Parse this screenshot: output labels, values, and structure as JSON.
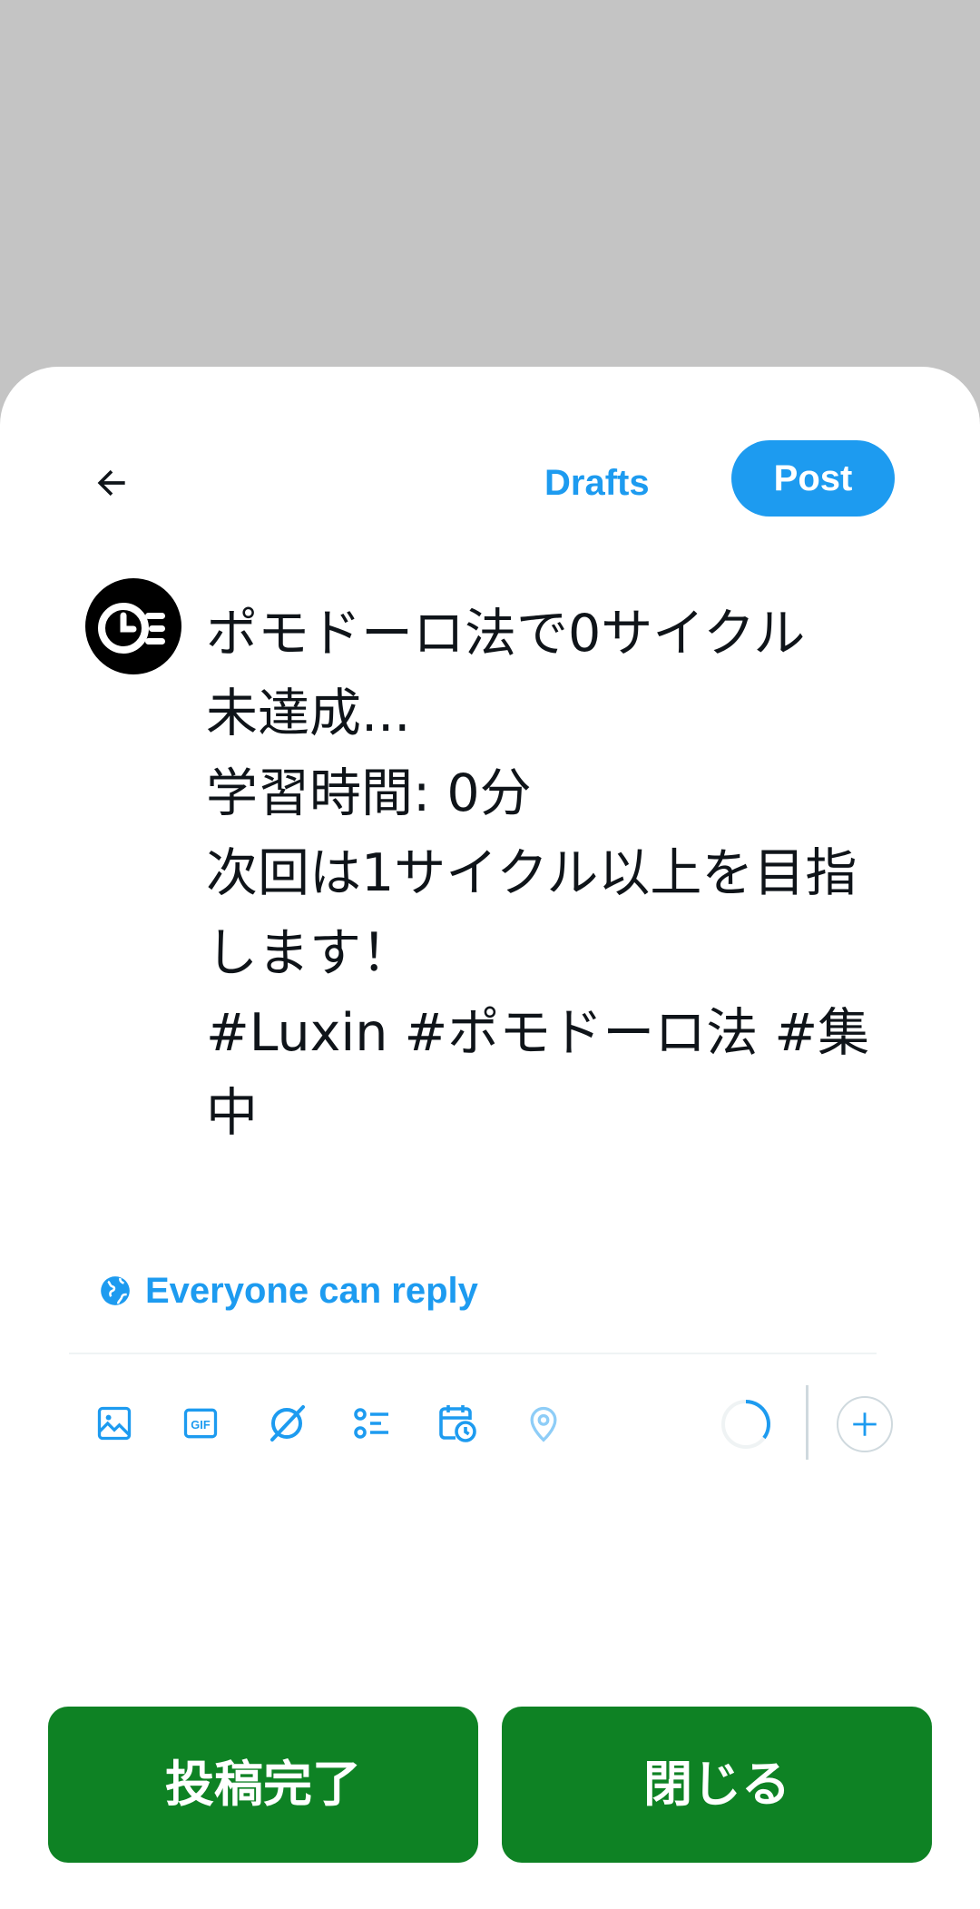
{
  "header": {
    "drafts_label": "Drafts",
    "post_label": "Post"
  },
  "compose": {
    "lines": [
      "ポモドーロ法で0サイクル",
      "未達成...",
      "学習時間: 0分",
      "次回は1サイクル以上を目指",
      "します！",
      "#Luxin #ポモドーロ法 #集",
      "中"
    ]
  },
  "reply_setting": {
    "label": "Everyone can reply"
  },
  "toolbar": {
    "icons": [
      "image-icon",
      "gif-icon",
      "grok-icon",
      "poll-icon",
      "schedule-icon",
      "location-icon"
    ]
  },
  "actions": {
    "complete_label": "投稿完了",
    "close_label": "閉じる"
  },
  "colors": {
    "accent": "#1d9bf0",
    "green": "#0e8224",
    "overlay": "#c4c4c4"
  }
}
